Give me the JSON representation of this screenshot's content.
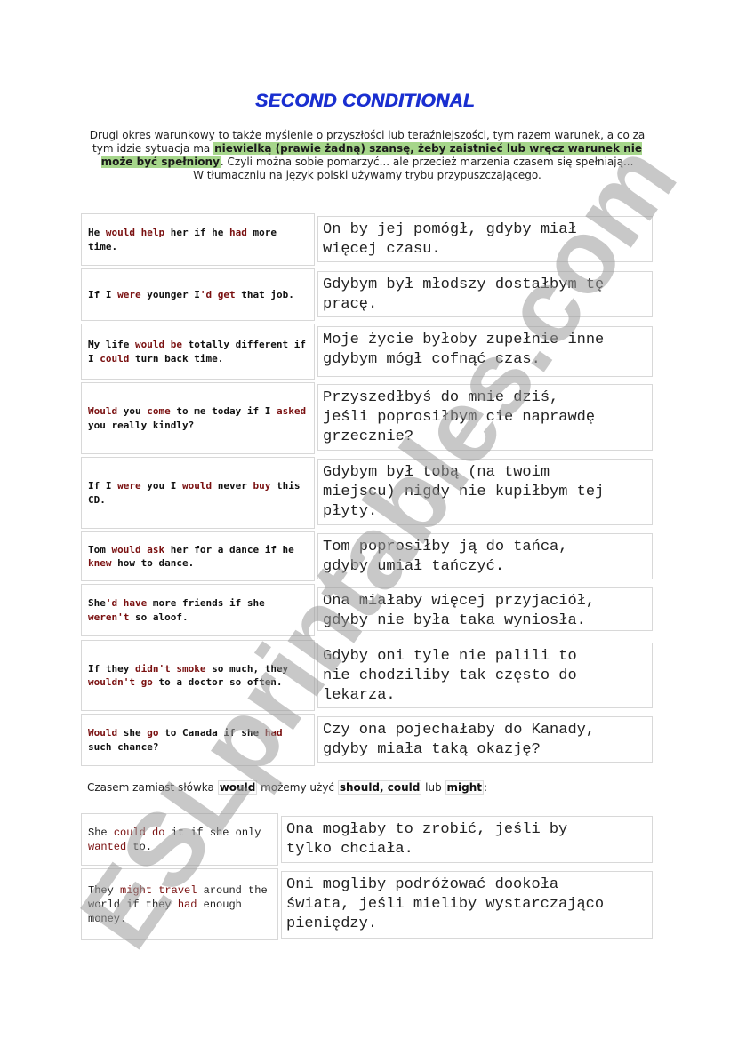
{
  "title": "SECOND CONDITIONAL",
  "intro": {
    "part1": "Drugi okres warunkowy to także myślenie o przyszłości lub teraźniejszości, tym razem warunek, a co za tym idzie sytuacja ma ",
    "highlight": "niewielką (prawie żadną) szansę, żeby zaistnieć lub wręcz warunek nie może być spełniony",
    "part2": ". Czyli można sobie pomarzyć... ale przecież marzenia czasem się spełniają...",
    "line2": "W tłumaczniu na język polski używamy trybu przypuszczającego.",
    "highlight_color": "#a6d68b"
  },
  "examples": [
    {
      "en": [
        [
          "He ",
          0
        ],
        [
          "would help",
          1
        ],
        [
          " her if he ",
          0
        ],
        [
          "had",
          1
        ],
        [
          " more time.",
          0
        ]
      ],
      "pl": "On by jej pomógł, gdyby miał\nwięcej czasu."
    },
    {
      "en": [
        [
          "If I ",
          0
        ],
        [
          "were",
          1
        ],
        [
          " younger I",
          0
        ],
        [
          "'d get",
          1
        ],
        [
          " that job.",
          0
        ]
      ],
      "pl": "Gdybym był młodszy dostałbym tę\npracę."
    },
    {
      "en": [
        [
          "My life ",
          0
        ],
        [
          "would be",
          1
        ],
        [
          " totally different if I ",
          0
        ],
        [
          "could",
          1
        ],
        [
          " turn back time.",
          0
        ]
      ],
      "pl": "Moje życie byłoby zupełnie inne\ngdybym mógł cofnąć czas."
    },
    {
      "en": [
        [
          "Would",
          1
        ],
        [
          " you ",
          0
        ],
        [
          "come",
          1
        ],
        [
          " to me today if I ",
          0
        ],
        [
          "asked",
          1
        ],
        [
          " you really kindly?",
          0
        ]
      ],
      "pl": "Przyszedłbyś do mnie dziś,\njeśli poprosiłbym cie naprawdę\ngrzecznie?"
    },
    {
      "en": [
        [
          "If I ",
          0
        ],
        [
          "were",
          1
        ],
        [
          " you I ",
          0
        ],
        [
          "would",
          1
        ],
        [
          " never ",
          0
        ],
        [
          "buy",
          1
        ],
        [
          " this CD.",
          0
        ]
      ],
      "pl": "Gdybym był tobą (na twoim\nmiejscu) nigdy nie kupiłbym tej\npłyty."
    },
    {
      "en": [
        [
          "Tom ",
          0
        ],
        [
          "would ask",
          1
        ],
        [
          " her for a dance if he ",
          0
        ],
        [
          "knew",
          1
        ],
        [
          " how to dance.",
          0
        ]
      ],
      "pl": "Tom poprosiłby ją do tańca,\ngdyby umiał tańczyć."
    },
    {
      "en": [
        [
          "She",
          0
        ],
        [
          "'d have",
          1
        ],
        [
          " more friends if she ",
          0
        ],
        [
          "weren't",
          1
        ],
        [
          " so aloof.",
          0
        ]
      ],
      "pl": "Ona miałaby więcej przyjaciół,\ngdyby nie była taka wyniosła."
    },
    {
      "en": [
        [
          "If they ",
          0
        ],
        [
          "didn't smoke",
          1
        ],
        [
          " so much, they ",
          0
        ],
        [
          "wouldn't go",
          1
        ],
        [
          " to a doctor so often.",
          0
        ]
      ],
      "pl": "Gdyby oni tyle nie palili to\nnie chodziliby tak często do\nlekarza."
    },
    {
      "en": [
        [
          "Would",
          1
        ],
        [
          " she ",
          0
        ],
        [
          "go",
          1
        ],
        [
          " to Canada if she ",
          0
        ],
        [
          "had",
          1
        ],
        [
          " such chance?",
          0
        ]
      ],
      "pl": "Czy ona pojechałaby do Kanady,\ngdyby miała taką okazję?"
    }
  ],
  "note": {
    "before": "Czasem zamiast słówka ",
    "w1": "would",
    "mid": " możemy użyć ",
    "w2": "should, could",
    "lub": " lub ",
    "w3": "might",
    "after": ":"
  },
  "modal_examples": [
    {
      "en": [
        [
          "She ",
          0
        ],
        [
          "could do",
          1
        ],
        [
          " it if she only ",
          0
        ],
        [
          "wanted",
          1
        ],
        [
          " to.",
          0
        ]
      ],
      "pl": "Ona mogłaby to zrobić, jeśli by\ntylko chciała."
    },
    {
      "en": [
        [
          "They ",
          0
        ],
        [
          "might travel",
          1
        ],
        [
          " around the world if they ",
          0
        ],
        [
          "had",
          1
        ],
        [
          " enough money.",
          0
        ]
      ],
      "pl": "Oni mogliby podróżować dookoła\nświata, jeśli mieliby wystarczająco\npieniędzy."
    }
  ],
  "watermark": "ESLprintables.com",
  "keyword_color": "#7a1010"
}
